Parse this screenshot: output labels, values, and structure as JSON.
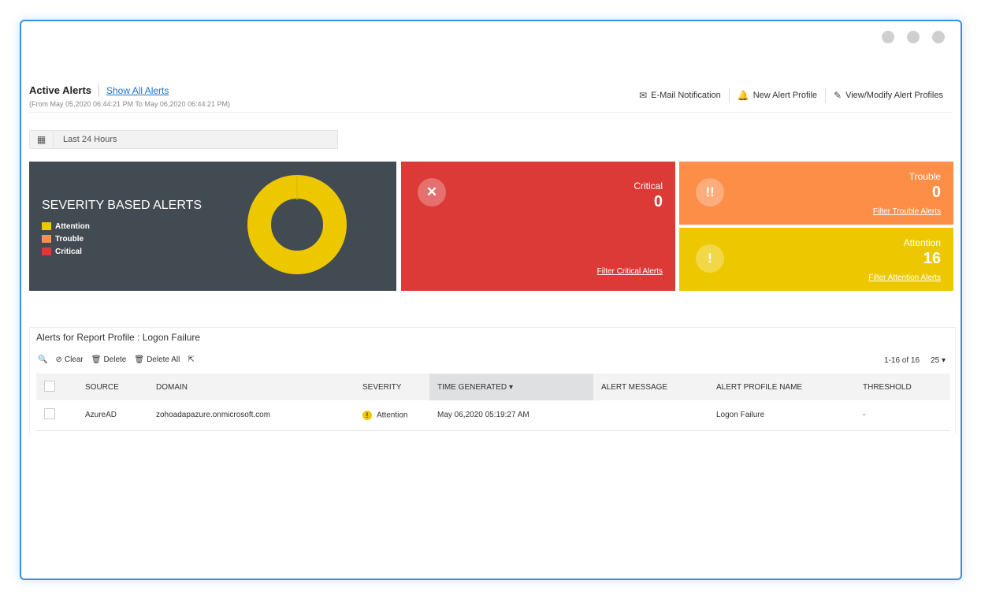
{
  "header": {
    "title": "Active Alerts",
    "show_all": "Show All Alerts",
    "date_range": "(From May 05,2020 06:44:21 PM To May 06,2020 06:44:21 PM)",
    "actions": [
      {
        "label": "E-Mail Notification",
        "icon": "email-icon"
      },
      {
        "label": "New Alert Profile",
        "icon": "new-profile-icon"
      },
      {
        "label": "View/Modify Alert Profiles",
        "icon": "edit-icon"
      }
    ]
  },
  "time_filter": {
    "label": "Last 24 Hours",
    "icon": "calendar-icon"
  },
  "severity_panel": {
    "title": "SEVERITY BASED ALERTS",
    "legend": [
      {
        "label": "Attention",
        "color": "#edc800"
      },
      {
        "label": "Trouble",
        "color": "#fc8e48"
      },
      {
        "label": "Critical",
        "color": "#dc3a36"
      }
    ],
    "donut": {
      "attention": 16,
      "trouble": 0,
      "critical": 0
    }
  },
  "cards": {
    "critical": {
      "name": "Critical",
      "value": "0",
      "link": "Filter Critical Alerts",
      "color": "#dc3a36",
      "icon": "close-icon"
    },
    "trouble": {
      "name": "Trouble",
      "value": "0",
      "link": "Filter Trouble Alerts",
      "color": "#fc8e48",
      "icon": "double-exclamation-icon"
    },
    "attention": {
      "name": "Attention",
      "value": "16",
      "link": "Filter Attention Alerts",
      "color": "#edc800",
      "icon": "exclamation-icon"
    }
  },
  "table": {
    "title": "Alerts for Report Profile : Logon Failure",
    "toolbar": {
      "clear": "Clear",
      "delete": "Delete",
      "delete_all": "Delete All"
    },
    "pager": {
      "range": "1-16 of 16",
      "page_size": "25"
    },
    "columns": [
      "SOURCE",
      "DOMAIN",
      "SEVERITY",
      "TIME GENERATED",
      "ALERT MESSAGE",
      "ALERT PROFILE NAME",
      "THRESHOLD"
    ],
    "rows": [
      {
        "source": "AzureAD",
        "domain": "zohoadapazure.onmicrosoft.com",
        "severity": "Attention",
        "time": "May 06,2020 05:19:27 AM",
        "message": "",
        "profile": "Logon Failure",
        "threshold": "-"
      }
    ]
  }
}
